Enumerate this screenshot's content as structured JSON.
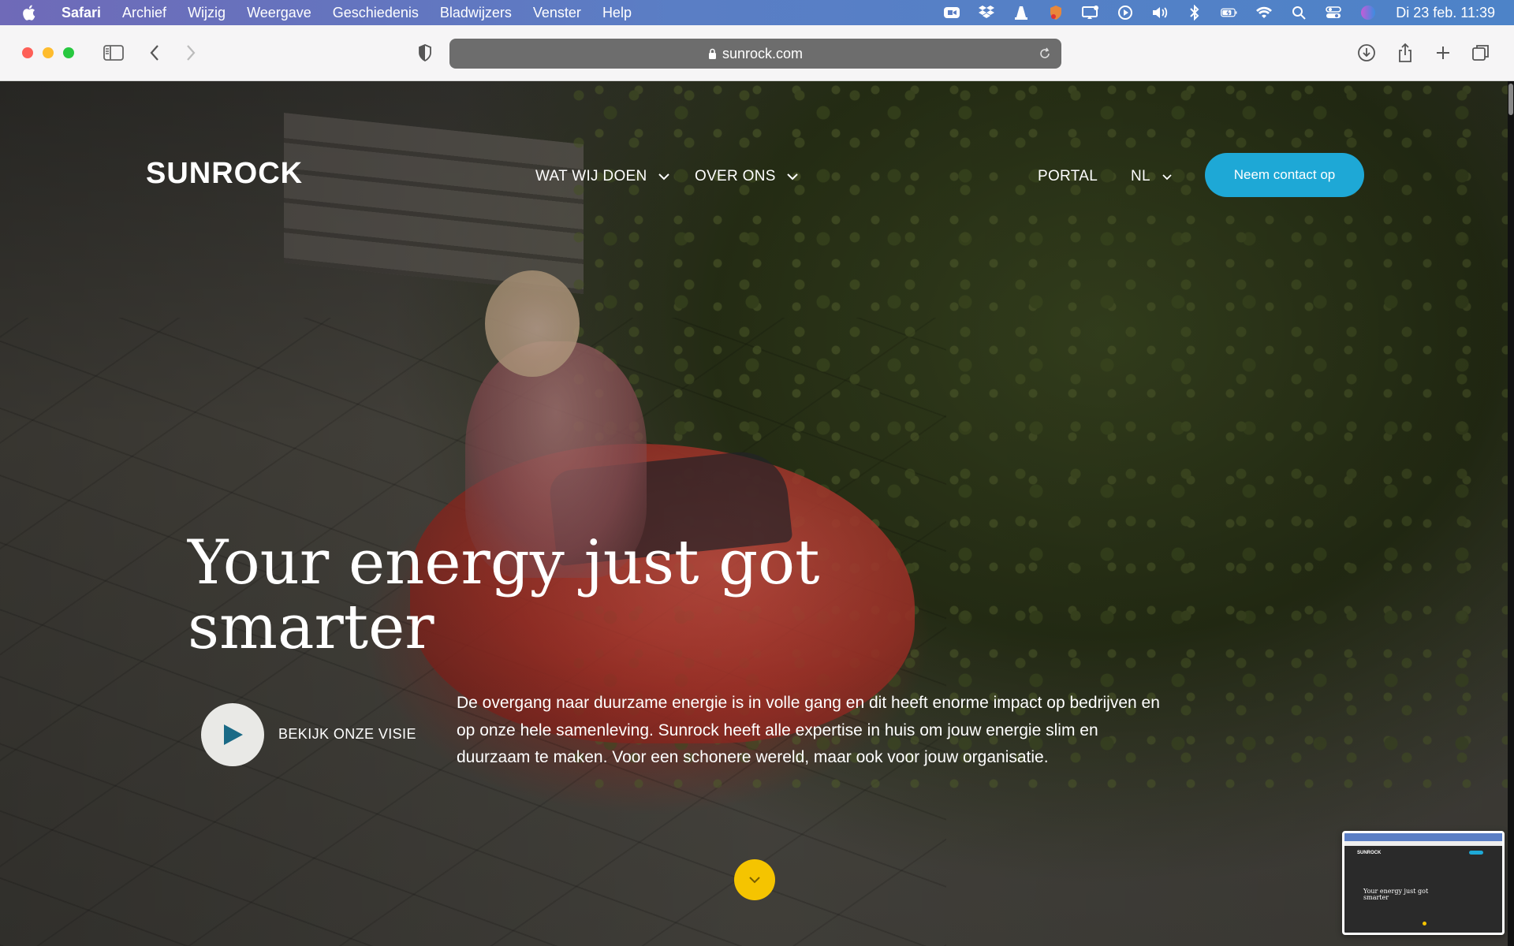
{
  "menubar": {
    "app": "Safari",
    "items": [
      "Archief",
      "Wijzig",
      "Weergave",
      "Geschiedenis",
      "Bladwijzers",
      "Venster",
      "Help"
    ],
    "clock": "Di 23 feb. 11:39"
  },
  "browser": {
    "url": "sunrock.com"
  },
  "site": {
    "logo": "SUNROCK",
    "nav": {
      "wat_wij_doen": "WAT WIJ DOEN",
      "over_ons": "OVER ONS",
      "portal": "PORTAL",
      "language": "NL"
    },
    "cta": "Neem contact op",
    "headline": "Your energy just got smarter",
    "video_label": "BEKIJK ONZE VISIE",
    "intro": "De overgang naar duurzame energie is in volle gang en dit heeft enorme impact op bedrijven en op onze hele samenleving. Sunrock heeft alle expertise in huis om jouw energie slim en duurzaam te maken. Voor een schonere wereld, maar ook voor jouw organisatie.",
    "accent_color": "#1ea8d6",
    "scroll_color": "#f5c400"
  },
  "thumbnail": {
    "logo": "SUNROCK",
    "headline": "Your energy just got smarter"
  }
}
